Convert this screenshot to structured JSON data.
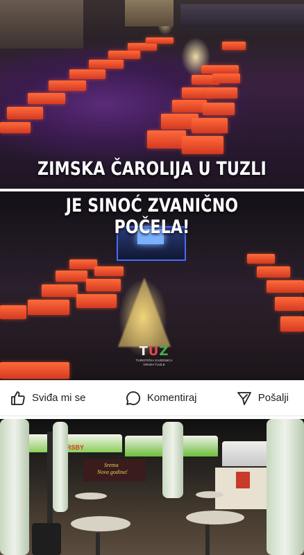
{
  "post": {
    "headline_line1": "ZIMSKA ČAROLIJA U TUZLI",
    "headline_line2": "JE SINOĆ ZVANIČNO POČELA!",
    "watermark": {
      "line1": "TURISTIČKA ZAJEDNICA",
      "line2": "GRADA TUZLE"
    }
  },
  "actions": {
    "like_label": "Sviđa mi se",
    "comment_label": "Komentiraj",
    "share_label": "Pošalji",
    "like_icon": "thumbs-up-icon",
    "comment_icon": "comment-bubble-icon",
    "share_icon": "send-icon"
  },
  "next_post": {
    "shop_sign": "RSBY",
    "banner_text_line1": "Sretna",
    "banner_text_line2": "Nova godina!"
  },
  "colors": {
    "stall_red": "#e24a2a",
    "crowd_purple": "#5a2a7a",
    "tent_green": "#4caf3a",
    "text_dark": "#1c1e21"
  }
}
